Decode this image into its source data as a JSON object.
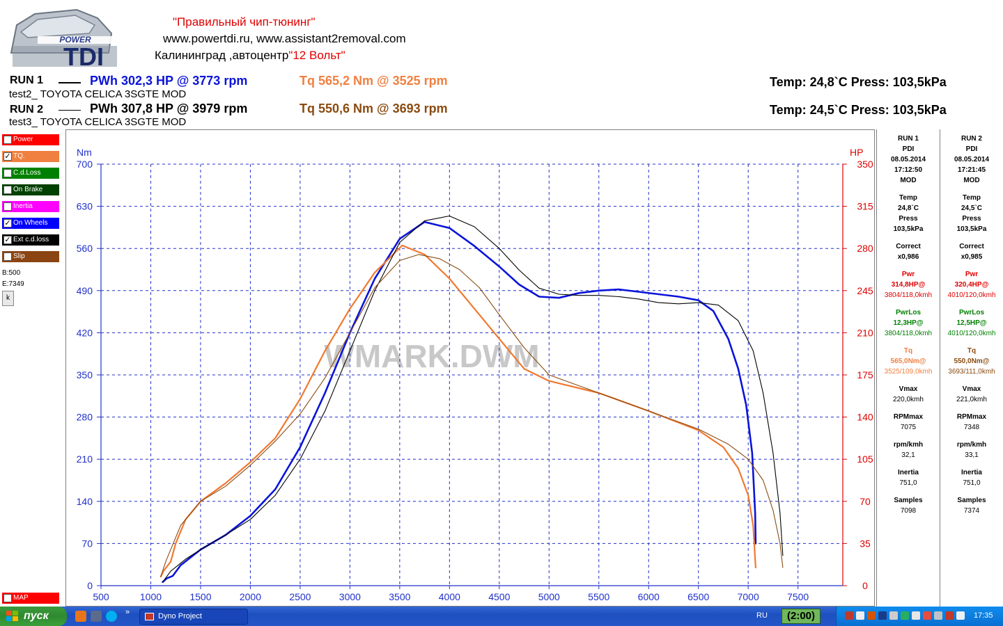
{
  "header": {
    "logo_text_power": "POWER",
    "logo_text_tdi": "TDI",
    "slogan": "\"Правильный чип-тюнинг\"",
    "sites": "www.powertdi.ru, www.assistant2removal.com",
    "city_prefix": "Калининград ,автоцентр",
    "city_center": "\"12 Вольт\""
  },
  "runs": [
    {
      "label": "RUN 1",
      "pwh": "PWh  302,3 HP @ 3773 rpm",
      "tq": "Tq 565,2 Nm @ 3525 rpm",
      "env": "Temp: 24,8`C    Press: 103,5kPa",
      "desc": "test2_ TOYOTA CELICA 3SGTE MOD"
    },
    {
      "label": "RUN 2",
      "pwh": "PWh  307,8 HP @ 3979 rpm",
      "tq": "Tq 550,6 Nm @ 3693 rpm",
      "env": "Temp: 24,5`C    Press: 103,5kPa",
      "desc": "test3_ TOYOTA CELICA 3SGTE MOD"
    }
  ],
  "channels": [
    {
      "label": "Power",
      "color": "#ff0000",
      "checked": ""
    },
    {
      "label": "TQ.",
      "color": "#f08040",
      "checked": "✓"
    },
    {
      "label": "C.d.Loss",
      "color": "#008000",
      "checked": ""
    },
    {
      "label": "On Brake",
      "color": "#004000",
      "checked": ""
    },
    {
      "label": "Inertia",
      "color": "#ff00ff",
      "checked": ""
    },
    {
      "label": "On Wheels",
      "color": "#0000ff",
      "checked": "✓"
    },
    {
      "label": "Ext c.d.loss",
      "color": "#000000",
      "checked": "✓"
    },
    {
      "label": "Slip",
      "color": "#8b4513",
      "checked": ""
    }
  ],
  "map_channel": {
    "label": "MAP",
    "color": "#ff0000"
  },
  "side_stats": {
    "b": "B:500",
    "e": "E:7349",
    "k": "k"
  },
  "info_panel": {
    "run1": {
      "title": "RUN 1",
      "shop": "PDI",
      "date": "08.05.2014",
      "time": "17:12:50",
      "mod": "MOD",
      "temp_label": "Temp",
      "temp": "24,8`C",
      "press_label": "Press",
      "press": "103,5kPa",
      "correct_label": "Correct",
      "correct": "x0,986",
      "pwr_label": "Pwr",
      "pwr": "314,8HP@",
      "pwr_at": "3804/118,0kmh",
      "pwrlos_label": "PwrLos",
      "pwrlos": "12,3HP@",
      "pwrlos_at": "3804/118,0kmh",
      "tq_label": "Tq",
      "tq": "565,0Nm@",
      "tq_at": "3525/109,0kmh",
      "vmax_label": "Vmax",
      "vmax": "220,0kmh",
      "rpmmax_label": "RPMmax",
      "rpmmax": "7075",
      "rpmkmh_label": "rpm/kmh",
      "rpmkmh": "32,1",
      "inertia_label": "Inertia",
      "inertia": "751,0",
      "samples_label": "Samples",
      "samples": "7098"
    },
    "run2": {
      "title": "RUN 2",
      "shop": "PDI",
      "date": "08.05.2014",
      "time": "17:21:45",
      "mod": "MOD",
      "temp_label": "Temp",
      "temp": "24,5`C",
      "press_label": "Press",
      "press": "103,5kPa",
      "correct_label": "Correct",
      "correct": "x0,985",
      "pwr_label": "Pwr",
      "pwr": "320,4HP@",
      "pwr_at": "4010/120,0kmh",
      "pwrlos_label": "PwrLos",
      "pwrlos": "12,5HP@",
      "pwrlos_at": "4010/120,0kmh",
      "tq_label": "Tq",
      "tq": "550,0Nm@",
      "tq_at": "3693/111,0kmh",
      "vmax_label": "Vmax",
      "vmax": "221,0kmh",
      "rpmmax_label": "RPMmax",
      "rpmmax": "7348",
      "rpmkmh_label": "rpm/kmh",
      "rpmkmh": "33,1",
      "inertia_label": "Inertia",
      "inertia": "751,0",
      "samples_label": "Samples",
      "samples": "7374"
    }
  },
  "taskbar": {
    "start_label": "пуск",
    "task_label": "Dyno Project",
    "lang": "RU",
    "timer": "(2:00)",
    "clock": "17:35"
  },
  "chart_data": {
    "type": "line",
    "title": "",
    "watermark": "WMARK.DWM",
    "xlabel": "",
    "ylabel_left": "Nm",
    "ylabel_right": "HP",
    "xlim": [
      500,
      7950
    ],
    "ylim_left": [
      0,
      700
    ],
    "ylim_right": [
      0,
      350
    ],
    "x_ticks": [
      500,
      1000,
      1500,
      2000,
      2500,
      3000,
      3500,
      4000,
      4500,
      5000,
      5500,
      6000,
      6500,
      7000,
      7500
    ],
    "y_ticks_left": [
      0,
      70,
      140,
      210,
      280,
      350,
      420,
      490,
      560,
      630,
      700
    ],
    "y_ticks_right": [
      0,
      35,
      70,
      105,
      140,
      175,
      210,
      245,
      280,
      315,
      350
    ],
    "grid": true,
    "series": [
      {
        "name": "RUN 1 PWh",
        "axis": "right",
        "color": "#0a14d8",
        "width": 2.6,
        "points": [
          [
            1120,
            3
          ],
          [
            1160,
            6
          ],
          [
            1220,
            8
          ],
          [
            1300,
            17
          ],
          [
            1500,
            30
          ],
          [
            1750,
            42
          ],
          [
            2000,
            58
          ],
          [
            2250,
            80
          ],
          [
            2500,
            115
          ],
          [
            2750,
            160
          ],
          [
            3000,
            210
          ],
          [
            3250,
            255
          ],
          [
            3500,
            288
          ],
          [
            3750,
            302
          ],
          [
            4000,
            297
          ],
          [
            4250,
            282
          ],
          [
            4500,
            265
          ],
          [
            4700,
            250
          ],
          [
            4900,
            240
          ],
          [
            5100,
            239
          ],
          [
            5300,
            243
          ],
          [
            5500,
            245
          ],
          [
            5700,
            246
          ],
          [
            5900,
            244
          ],
          [
            6100,
            242
          ],
          [
            6300,
            240
          ],
          [
            6500,
            237
          ],
          [
            6650,
            228
          ],
          [
            6800,
            205
          ],
          [
            6900,
            180
          ],
          [
            6980,
            150
          ],
          [
            7040,
            110
          ],
          [
            7070,
            60
          ],
          [
            7075,
            35
          ]
        ]
      },
      {
        "name": "RUN 1 Tq",
        "axis": "left",
        "color": "#f07830",
        "width": 2.2,
        "points": [
          [
            1100,
            15
          ],
          [
            1130,
            25
          ],
          [
            1200,
            40
          ],
          [
            1250,
            70
          ],
          [
            1350,
            110
          ],
          [
            1500,
            140
          ],
          [
            1750,
            170
          ],
          [
            2000,
            205
          ],
          [
            2250,
            245
          ],
          [
            2500,
            310
          ],
          [
            2750,
            390
          ],
          [
            3000,
            460
          ],
          [
            3250,
            520
          ],
          [
            3525,
            565
          ],
          [
            3750,
            550
          ],
          [
            4000,
            510
          ],
          [
            4250,
            460
          ],
          [
            4500,
            410
          ],
          [
            4750,
            360
          ],
          [
            5000,
            340
          ],
          [
            5500,
            320
          ],
          [
            6000,
            290
          ],
          [
            6500,
            258
          ],
          [
            6750,
            230
          ],
          [
            6900,
            195
          ],
          [
            7000,
            150
          ],
          [
            7050,
            100
          ],
          [
            7075,
            30
          ]
        ]
      },
      {
        "name": "RUN 2 PWh",
        "axis": "right",
        "color": "#000000",
        "width": 1.1,
        "points": [
          [
            1120,
            3
          ],
          [
            1200,
            12
          ],
          [
            1350,
            22
          ],
          [
            1500,
            30
          ],
          [
            1750,
            42
          ],
          [
            2000,
            55
          ],
          [
            2250,
            75
          ],
          [
            2500,
            105
          ],
          [
            2750,
            145
          ],
          [
            3000,
            195
          ],
          [
            3250,
            245
          ],
          [
            3500,
            285
          ],
          [
            3750,
            303
          ],
          [
            4000,
            307
          ],
          [
            4250,
            298
          ],
          [
            4500,
            280
          ],
          [
            4700,
            262
          ],
          [
            4900,
            247
          ],
          [
            5100,
            242
          ],
          [
            5300,
            241
          ],
          [
            5500,
            241
          ],
          [
            5700,
            240
          ],
          [
            5900,
            238
          ],
          [
            6100,
            235
          ],
          [
            6300,
            234
          ],
          [
            6500,
            235
          ],
          [
            6700,
            233
          ],
          [
            6900,
            220
          ],
          [
            7050,
            195
          ],
          [
            7150,
            160
          ],
          [
            7250,
            110
          ],
          [
            7320,
            60
          ],
          [
            7348,
            25
          ]
        ]
      },
      {
        "name": "RUN 2 Tq",
        "axis": "left",
        "color": "#8a4a10",
        "width": 1.1,
        "points": [
          [
            1100,
            15
          ],
          [
            1150,
            40
          ],
          [
            1200,
            60
          ],
          [
            1300,
            100
          ],
          [
            1500,
            140
          ],
          [
            1750,
            165
          ],
          [
            2000,
            200
          ],
          [
            2250,
            240
          ],
          [
            2500,
            285
          ],
          [
            2750,
            345
          ],
          [
            3000,
            420
          ],
          [
            3250,
            495
          ],
          [
            3500,
            540
          ],
          [
            3693,
            550
          ],
          [
            3900,
            543
          ],
          [
            4100,
            525
          ],
          [
            4300,
            495
          ],
          [
            4500,
            450
          ],
          [
            4750,
            395
          ],
          [
            5000,
            350
          ],
          [
            5500,
            320
          ],
          [
            6000,
            290
          ],
          [
            6500,
            260
          ],
          [
            6800,
            235
          ],
          [
            7000,
            210
          ],
          [
            7150,
            175
          ],
          [
            7250,
            125
          ],
          [
            7320,
            70
          ],
          [
            7348,
            30
          ]
        ]
      }
    ]
  }
}
